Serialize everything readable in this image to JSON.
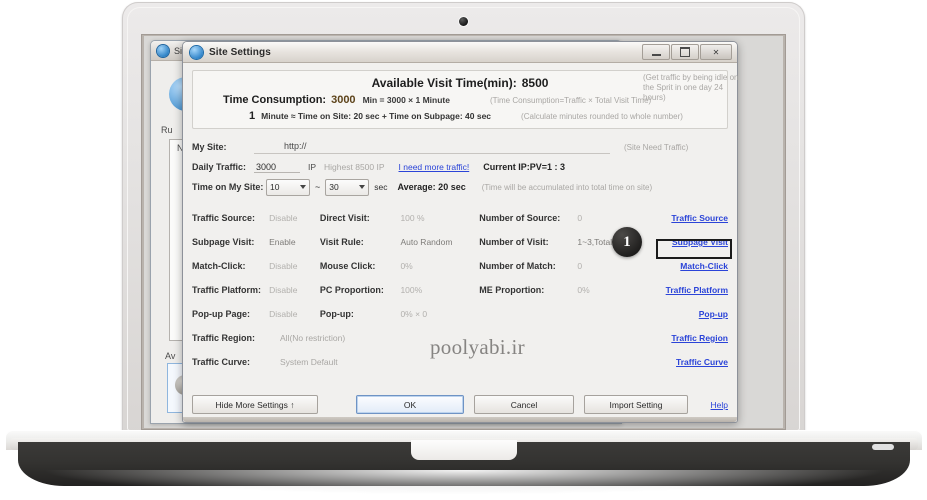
{
  "background_window": {
    "title": "Site Settings",
    "labels": [
      "Ru",
      "Nu",
      "Av"
    ]
  },
  "dialog": {
    "title": "Site Settings",
    "window_buttons": {
      "minimize": "minimize-icon",
      "maximize": "maximize-icon",
      "close": "✕"
    },
    "header": {
      "available_label": "Available Visit Time(min):",
      "available_value": "8500",
      "time_consumption_label": "Time Consumption:",
      "time_consumption_value": "3000",
      "time_consumption_formula": "Min = 3000 ×  1   Minute",
      "time_consumption_hint": "(Time Consumption=Traffic × Total Visit Time)",
      "minute_number": "1",
      "minute_formula": "Minute ≈ Time on Site: 20 sec + Time on Subpage: 40 sec",
      "minute_hint": "(Calculate minutes rounded to whole number)"
    },
    "form": {
      "my_site_label": "My Site:",
      "my_site_value": "http://",
      "my_site_hint": "(Site Need Traffic)",
      "daily_traffic_label": "Daily Traffic:",
      "daily_traffic_value": "3000",
      "daily_traffic_unit": "IP",
      "highest_text": "Highest 8500 IP",
      "more_traffic_link": "I need more traffic!",
      "current_ratio": "Current IP:PV=1 : 3",
      "traffic_hint": "(Get traffic by being idle on the Sprit in one day 24 hours)",
      "time_on_site_label": "Time on My Site:",
      "time_min": "10",
      "time_tilde": "~",
      "time_max": "30",
      "time_unit": "sec",
      "average_text": "Average: 20 sec",
      "time_hint": "(Time will be accumulated into total time on site)"
    },
    "settings_rows": [
      {
        "label": "Traffic Source:",
        "state": "Disable",
        "state_on": false,
        "mid_label": "Direct Visit:",
        "mid_value": "100 %",
        "right_label": "Number of Source:",
        "right_value": "0",
        "link": "Traffic Source"
      },
      {
        "label": "Subpage Visit:",
        "state": "Enable",
        "state_on": true,
        "mid_label": "Visit Rule:",
        "mid_value": "Auto Random",
        "right_label": "Number of Visit:",
        "right_value": "1~3,Total 4",
        "link": "Subpage Visit"
      },
      {
        "label": "Match-Click:",
        "state": "Disable",
        "state_on": false,
        "mid_label": "Mouse Click:",
        "mid_value": "0%",
        "right_label": "Number of Match:",
        "right_value": "0",
        "link": "Match-Click"
      },
      {
        "label": "Traffic Platform:",
        "state": "Disable",
        "state_on": false,
        "mid_label": "PC Proportion:",
        "mid_value": "100%",
        "right_label": "ME Proportion:",
        "right_value": "0%",
        "link": "Traffic Platform"
      },
      {
        "label": "Pop-up Page:",
        "state": "Disable",
        "state_on": false,
        "mid_label": "Pop-up:",
        "mid_value": "0% × 0",
        "right_label": "",
        "right_value": "",
        "link": "Pop-up"
      },
      {
        "label": "Traffic Region:",
        "state": "All(No restriction)",
        "state_on": false,
        "mid_label": "",
        "mid_value": "",
        "right_label": "",
        "right_value": "",
        "link": "Traffic Region"
      },
      {
        "label": "Traffic Curve:",
        "state": "System Default",
        "state_on": false,
        "mid_label": "",
        "mid_value": "",
        "right_label": "",
        "right_value": "",
        "link": "Traffic Curve"
      }
    ],
    "callout_badge": "1",
    "watermark": "poolyabi.ir",
    "footer": {
      "hide_more": "Hide More Settings ↑",
      "ok": "OK",
      "cancel": "Cancel",
      "import": "Import Setting",
      "help": "Help"
    }
  },
  "colors": {
    "link": "#2b44d8",
    "accent_value": "#6a4a14",
    "badge": "#1c1b1a",
    "dialog_bg": "#f1f0ee"
  }
}
